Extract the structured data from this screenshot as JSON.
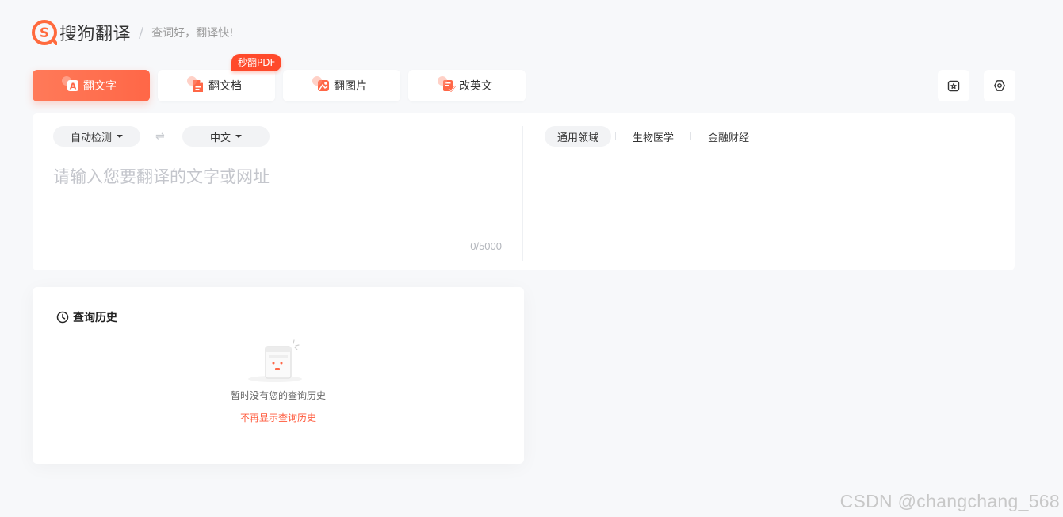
{
  "header": {
    "logo_text": "搜狗翻译",
    "slogan": "查词好，翻译快!"
  },
  "tabs": [
    {
      "label": "翻文字",
      "icon": "text-translate-icon",
      "active": true
    },
    {
      "label": "翻文档",
      "icon": "document-icon",
      "active": false
    },
    {
      "label": "翻图片",
      "icon": "image-icon",
      "active": false
    },
    {
      "label": "改英文",
      "icon": "edit-check-icon",
      "active": false
    }
  ],
  "badge": "秒翻PDF",
  "tools": [
    {
      "icon": "favorites-icon"
    },
    {
      "icon": "settings-icon"
    }
  ],
  "translator": {
    "source_lang": "自动检测",
    "target_lang": "中文",
    "swap_icon": "swap-icon",
    "input_placeholder": "请输入您要翻译的文字或网址",
    "input_value": "",
    "counter": "0/5000",
    "domains": [
      "通用领域",
      "生物医学",
      "金融财经"
    ],
    "active_domain": "通用领域"
  },
  "history": {
    "title": "查询历史",
    "empty_text": "暂时没有您的查询历史",
    "hide_link": "不再显示查询历史"
  },
  "watermark": "CSDN @changchang_568",
  "colors": {
    "accent": "#ff6747",
    "badge": "#ff4a2b",
    "background": "#f7f8fa"
  }
}
